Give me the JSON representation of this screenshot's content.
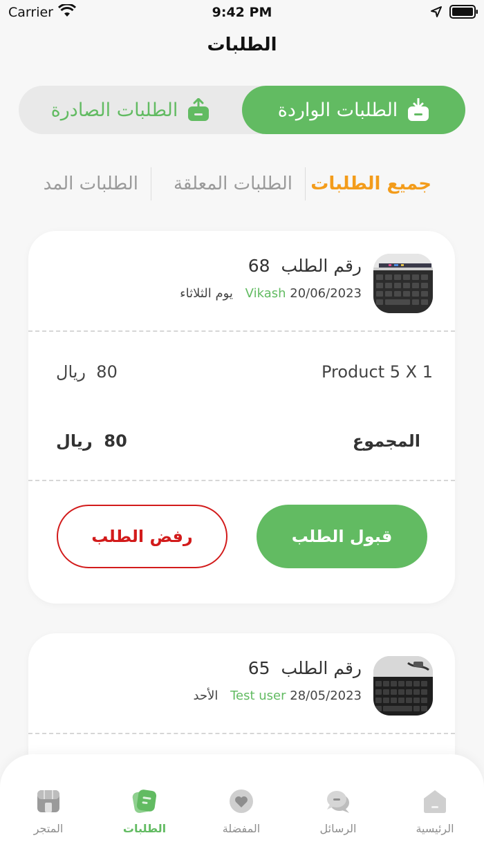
{
  "status_bar": {
    "carrier": "Carrier",
    "time": "9:42 PM"
  },
  "page": {
    "title": "الطلبات"
  },
  "segments": {
    "incoming": "الطلبات الواردة",
    "outgoing": "الطلبات الصادرة"
  },
  "filters": [
    "جميع الطلبات",
    "الطلبات المعلقة",
    "الطلبات المد"
  ],
  "orders": [
    {
      "order_label": "رقم الطلب",
      "order_number": "68",
      "user": "Vikash",
      "date": "20/06/2023 يوم الثلاثاء",
      "product_name": "Product 5",
      "product_qty": "X 1",
      "product_price": "80",
      "currency": "ريال",
      "total_label": "المجموع",
      "total_price": "80",
      "accept_label": "قبول الطلب",
      "reject_label": "رفض الطلب"
    },
    {
      "order_label": "رقم الطلب",
      "order_number": "65",
      "user": "Test user",
      "date": "28/05/2023 الأحد"
    }
  ],
  "tabbar": {
    "home": "الرئيسية",
    "messages": "الرسائل",
    "favorites": "المفضلة",
    "orders": "الطلبات",
    "store": "المتجر"
  },
  "colors": {
    "primary": "#62bb62",
    "accent": "#f39c1b",
    "danger": "#d21b1b"
  },
  "icons": [
    "wifi-icon",
    "location-arrow-icon",
    "battery-icon",
    "inbox-download-icon",
    "inbox-upload-icon",
    "home-icon",
    "chat-icon",
    "heart-icon",
    "note-icon",
    "store-icon"
  ]
}
